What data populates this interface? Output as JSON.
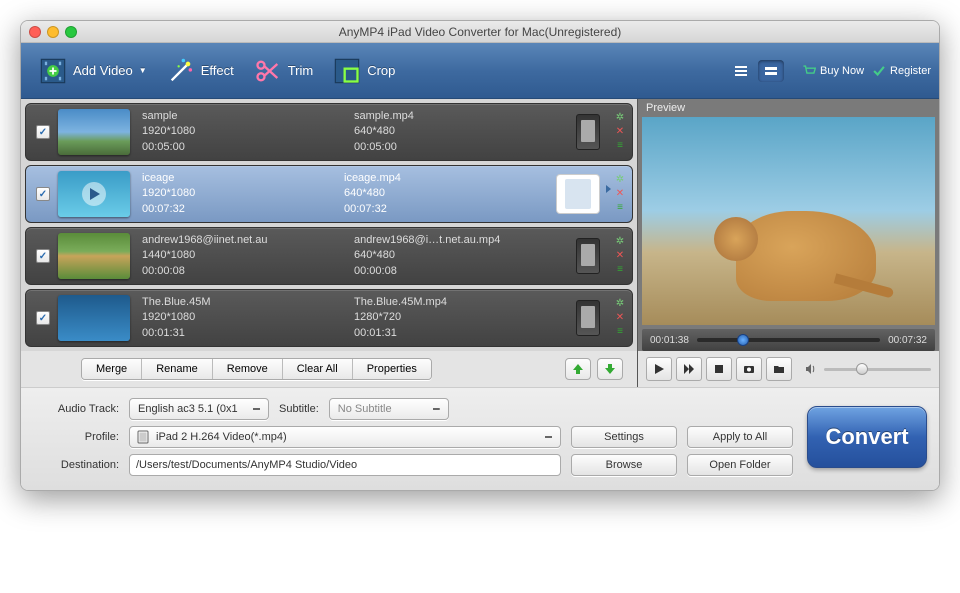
{
  "window": {
    "title": "AnyMP4 iPad Video Converter for Mac(Unregistered)"
  },
  "toolbar": {
    "addvideo": "Add Video",
    "effect": "Effect",
    "trim": "Trim",
    "crop": "Crop",
    "buynow": "Buy Now",
    "register": "Register"
  },
  "preview": {
    "label": "Preview",
    "current": "00:01:38",
    "total": "00:07:32"
  },
  "files": [
    {
      "name": "sample",
      "res": "1920*1080",
      "dur": "00:05:00",
      "out": "sample.mp4",
      "ores": "640*480",
      "odur": "00:05:00",
      "selected": false,
      "device": "phone",
      "thumb": "sky"
    },
    {
      "name": "iceage",
      "res": "1920*1080",
      "dur": "00:07:32",
      "out": "iceage.mp4",
      "ores": "640*480",
      "odur": "00:07:32",
      "selected": true,
      "device": "ipad",
      "thumb": "ice"
    },
    {
      "name": "andrew1968@iinet.net.au",
      "res": "1440*1080",
      "dur": "00:00:08",
      "out": "andrew1968@i…t.net.au.mp4",
      "ores": "640*480",
      "odur": "00:00:08",
      "selected": false,
      "device": "phone",
      "thumb": "garden"
    },
    {
      "name": "The.Blue.45M",
      "res": "1920*1080",
      "dur": "00:01:31",
      "out": "The.Blue.45M.mp4",
      "ores": "1280*720",
      "odur": "00:01:31",
      "selected": false,
      "device": "phone",
      "thumb": "water"
    }
  ],
  "actions": {
    "merge": "Merge",
    "rename": "Rename",
    "remove": "Remove",
    "clearall": "Clear All",
    "properties": "Properties"
  },
  "bottom": {
    "audiotrack_label": "Audio Track:",
    "audiotrack_value": "English ac3 5.1 (0x1",
    "subtitle_label": "Subtitle:",
    "subtitle_value": "No Subtitle",
    "profile_label": "Profile:",
    "profile_value": "iPad 2 H.264 Video(*.mp4)",
    "destination_label": "Destination:",
    "destination_value": "/Users/test/Documents/AnyMP4 Studio/Video",
    "settings": "Settings",
    "applyall": "Apply to All",
    "browse": "Browse",
    "openfolder": "Open Folder",
    "convert": "Convert"
  }
}
